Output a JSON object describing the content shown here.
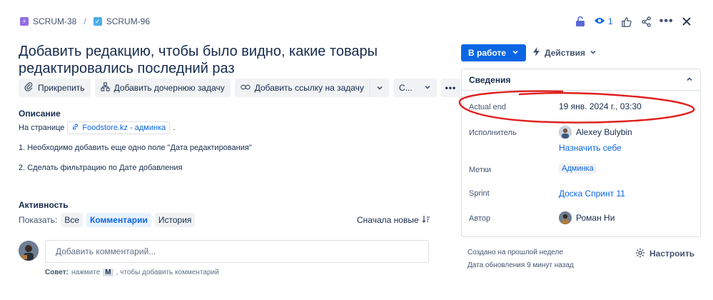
{
  "breadcrumb": {
    "parent_key": "SCRUM-38",
    "separator": "/",
    "issue_key": "SCRUM-96",
    "parent_icon": "epic-icon",
    "issue_icon": "task-checkbox-icon"
  },
  "header_actions": {
    "lock_icon": "unlock-icon",
    "watch_count": "1",
    "watch_icon": "eye-icon",
    "like_icon": "thumbs-up-icon",
    "share_icon": "share-icon",
    "more_icon": "more-icon",
    "close_icon": "close-icon"
  },
  "issue": {
    "title": "Добавить редакцию, чтобы было видно, какие товары редактировались последний раз"
  },
  "toolbar": {
    "attach_label": "Прикрепить",
    "add_child_label": "Добавить дочернюю задачу",
    "add_link_label": "Добавить ссылку на задачу",
    "more_label": "С..."
  },
  "description": {
    "heading": "Описание",
    "line1_prefix": "На странице",
    "link_text": "Foodstore.kz - админка",
    "line1_suffix": ".",
    "item1": "1. Необходимо добавить еще одно поле \"Дата редактирования\"",
    "item2": "2. Сделать фильтрацию по Дате добавления"
  },
  "activity": {
    "heading": "Активность",
    "show_label": "Показать:",
    "filters": [
      "Все",
      "Комментарии",
      "История"
    ],
    "active_filter": "Комментарии",
    "sort_label": "Сначала новые",
    "comment_placeholder": "Добавить комментарий...",
    "tip_label": "Совет:",
    "tip_text_before": "нажмите",
    "tip_key": "M",
    "tip_text_after": ", чтобы добавить комментарий"
  },
  "status": {
    "label": "В работе",
    "actions_label": "Действия"
  },
  "details": {
    "heading": "Сведения",
    "fields": {
      "actual_end": {
        "label": "Actual end",
        "value": "19 янв. 2024 г., 03:30"
      },
      "assignee": {
        "label": "Исполнитель",
        "value": "Alexey Bulybin",
        "assign_self": "Назначить себе"
      },
      "labels": {
        "label": "Метки",
        "value": "Админка"
      },
      "sprint": {
        "label": "Sprint",
        "value": "Доска Спринт 11"
      },
      "reporter": {
        "label": "Автор",
        "value": "Роман Ни"
      }
    }
  },
  "meta": {
    "created": "Создано на прошлой неделе",
    "updated": "Дата обновления 9 минут назад",
    "configure_label": "Настроить"
  },
  "colors": {
    "primary": "#0c66e4",
    "annotation": "#e0201f",
    "epic": "#8f6de0",
    "task": "#4bade8"
  }
}
